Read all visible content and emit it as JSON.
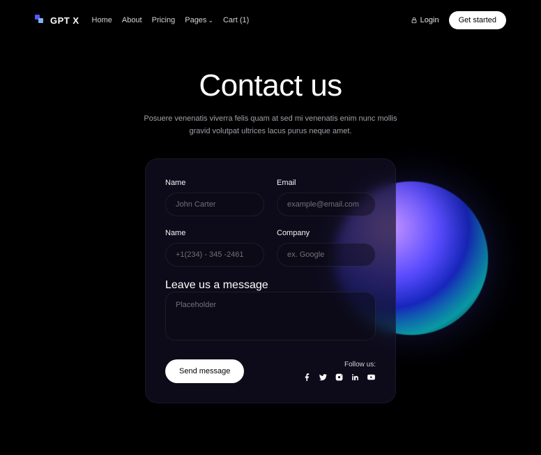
{
  "brand": "GPT X",
  "nav": {
    "home": "Home",
    "about": "About",
    "pricing": "Pricing",
    "pages": "Pages",
    "cart": "Cart (1)"
  },
  "auth": {
    "login": "Login",
    "get_started": "Get started"
  },
  "hero": {
    "title": "Contact us",
    "subtitle": "Posuere venenatis viverra felis quam at sed mi venenatis enim nunc mollis gravid volutpat ultrices lacus purus neque amet."
  },
  "form": {
    "name_label": "Name",
    "name_placeholder": "John Carter",
    "email_label": "Email",
    "email_placeholder": "example@email.com",
    "phone_label": "Name",
    "phone_placeholder": "+1(234) - 345 -2461",
    "company_label": "Company",
    "company_placeholder": "ex. Google",
    "message_label": "Leave us a message",
    "message_placeholder": "Placeholder",
    "submit": "Send message"
  },
  "follow": {
    "label": "Follow us:"
  }
}
